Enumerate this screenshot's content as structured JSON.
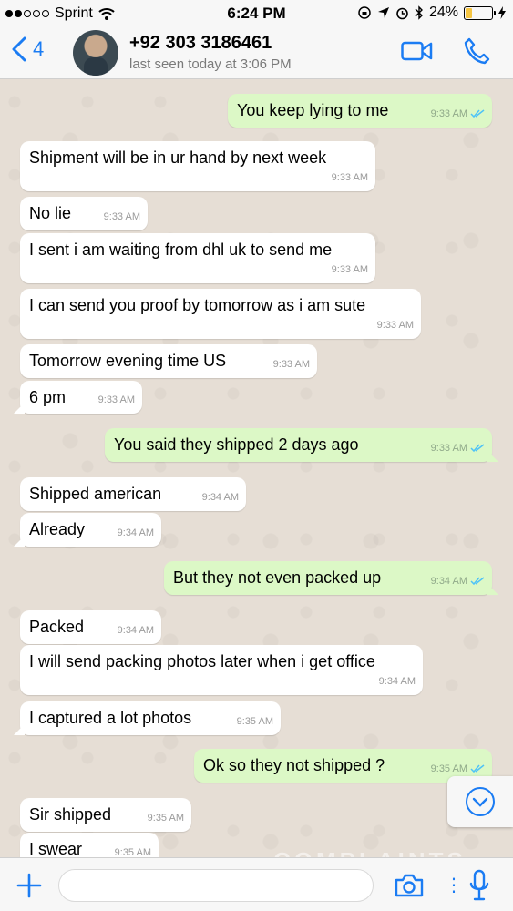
{
  "status_bar": {
    "carrier": "Sprint",
    "time": "6:24 PM",
    "battery": "24%",
    "battery_level": 0.24
  },
  "header": {
    "back_count": "4",
    "contact": "+92 303 3186461",
    "last_seen": "last seen today at 3:06 PM"
  },
  "messages": [
    {
      "dir": "out",
      "text": "You keep lying to me",
      "time": "9:33 AM"
    },
    {
      "dir": "in",
      "text": "Shipment will be in ur hand by next week",
      "time": "9:33 AM"
    },
    {
      "dir": "in",
      "text": "No lie",
      "time": "9:33 AM"
    },
    {
      "dir": "in",
      "text": "I sent i am waiting from dhl uk to send me",
      "time": "9:33 AM"
    },
    {
      "dir": "in",
      "text": "I can send you proof by tomorrow as i am sute",
      "time": "9:33 AM"
    },
    {
      "dir": "in",
      "text": "Tomorrow evening time US",
      "time": "9:33 AM"
    },
    {
      "dir": "in",
      "text": "6 pm",
      "time": "9:33 AM"
    },
    {
      "dir": "out",
      "text": "You said they shipped 2 days ago",
      "time": "9:33 AM"
    },
    {
      "dir": "in",
      "text": "Shipped american",
      "time": "9:34 AM"
    },
    {
      "dir": "in",
      "text": "Already",
      "time": "9:34 AM"
    },
    {
      "dir": "out",
      "text": "But they not even packed up",
      "time": "9:34 AM"
    },
    {
      "dir": "in",
      "text": "Packed",
      "time": "9:34 AM"
    },
    {
      "dir": "in",
      "text": "I will send packing photos later when i get office",
      "time": "9:34 AM"
    },
    {
      "dir": "in",
      "text": "I captured a lot photos",
      "time": "9:35 AM"
    },
    {
      "dir": "out",
      "text": "Ok so they not shipped ?",
      "time": "9:35 AM"
    },
    {
      "dir": "in",
      "text": "Sir shipped",
      "time": "9:35 AM"
    },
    {
      "dir": "in",
      "text": "I swear",
      "time": "9:35 AM"
    }
  ],
  "composer": {
    "placeholder": ""
  },
  "watermark": "COMPLAINTS",
  "colors": {
    "accent": "#1b7cf3",
    "outgoing": "#dcf8c6",
    "incoming": "#ffffff",
    "tick": "#4fc3f7"
  },
  "icons": [
    "wifi-icon",
    "lock-rotation-icon",
    "location-icon",
    "alarm-icon",
    "bluetooth-icon",
    "charging-icon",
    "back-chevron-icon",
    "video-icon",
    "phone-icon",
    "double-check-icon",
    "scroll-down-icon",
    "plus-icon",
    "camera-icon",
    "mic-icon"
  ]
}
